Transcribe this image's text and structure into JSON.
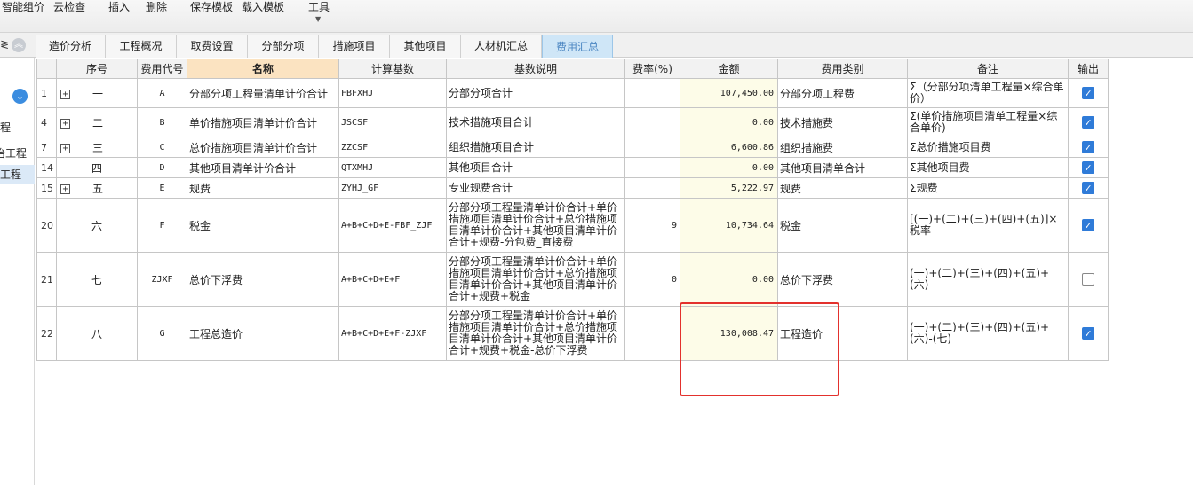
{
  "toolbar": {
    "items": [
      "智能组价",
      "云检查",
      "插入",
      "删除",
      "保存模板",
      "载入模板",
      "工具"
    ]
  },
  "tabs": [
    {
      "label": "造价分析",
      "active": false
    },
    {
      "label": "工程概况",
      "active": false
    },
    {
      "label": "取费设置",
      "active": false
    },
    {
      "label": "分部分项",
      "active": false
    },
    {
      "label": "措施项目",
      "active": false
    },
    {
      "label": "其他项目",
      "active": false
    },
    {
      "label": "人材机汇总",
      "active": false
    },
    {
      "label": "费用汇总",
      "active": true
    }
  ],
  "left_panel": {
    "cut_label": "≷",
    "items": [
      "程",
      "治工程",
      "治工程"
    ]
  },
  "table": {
    "headers": [
      "序号",
      "费用代号",
      "名称",
      "计算基数",
      "基数说明",
      "费率(%)",
      "金额",
      "费用类别",
      "备注",
      "输出"
    ],
    "rows": [
      {
        "rownum": "1",
        "expand": "+",
        "seq": "一",
        "code": "A",
        "name": "分部分项工程量清单计价合计",
        "base": "FBFXHJ",
        "desc": "分部分项合计",
        "rate": "",
        "amount": "107,450.00",
        "category": "分部分项工程费",
        "note": "Σ（分部分项清单工程量×综合单价）",
        "output": true
      },
      {
        "rownum": "4",
        "expand": "+",
        "seq": "二",
        "code": "B",
        "name": "单价措施项目清单计价合计",
        "base": "JSCSF",
        "desc": "技术措施项目合计",
        "rate": "",
        "amount": "0.00",
        "category": "技术措施费",
        "note": "Σ(单价措施项目清单工程量×综合单价)",
        "output": true
      },
      {
        "rownum": "7",
        "expand": "+",
        "seq": "三",
        "code": "C",
        "name": "总价措施项目清单计价合计",
        "base": "ZZCSF",
        "desc": "组织措施项目合计",
        "rate": "",
        "amount": "6,600.86",
        "category": "组织措施费",
        "note": "Σ总价措施项目费",
        "output": true
      },
      {
        "rownum": "14",
        "expand": "",
        "seq": "四",
        "code": "D",
        "name": "其他项目清单计价合计",
        "base": "QTXMHJ",
        "desc": "其他项目合计",
        "rate": "",
        "amount": "0.00",
        "category": "其他项目清单合计",
        "note": "Σ其他项目费",
        "output": true
      },
      {
        "rownum": "15",
        "expand": "+",
        "seq": "五",
        "code": "E",
        "name": "规费",
        "base": "ZYHJ_GF",
        "desc": "专业规费合计",
        "rate": "",
        "amount": "5,222.97",
        "category": "规费",
        "note": "Σ规费",
        "output": true
      },
      {
        "rownum": "20",
        "expand": "",
        "seq": "六",
        "code": "F",
        "name": "税金",
        "base": "A+B+C+D+E-FBF_ZJF",
        "desc": "分部分项工程量清单计价合计+单价措施项目清单计价合计+总价措施项目清单计价合计+其他项目清单计价合计+规费-分包费_直接费",
        "rate": "9",
        "amount": "10,734.64",
        "category": "税金",
        "note": "[(一)+(二)+(三)+(四)+(五)]×税率",
        "output": true
      },
      {
        "rownum": "21",
        "expand": "",
        "seq": "七",
        "code": "ZJXF",
        "name": "总价下浮费",
        "base": "A+B+C+D+E+F",
        "desc": "分部分项工程量清单计价合计+单价措施项目清单计价合计+总价措施项目清单计价合计+其他项目清单计价合计+规费+税金",
        "rate": "0",
        "amount": "0.00",
        "category": "总价下浮费",
        "note": "(一)+(二)+(三)+(四)+(五)+(六)",
        "output": false
      },
      {
        "rownum": "22",
        "expand": "",
        "seq": "八",
        "code": "G",
        "name": "工程总造价",
        "base": "A+B+C+D+E+F-ZJXF",
        "desc": "分部分项工程量清单计价合计+单价措施项目清单计价合计+总价措施项目清单计价合计+其他项目清单计价合计+规费+税金-总价下浮费",
        "rate": "",
        "amount": "130,008.47",
        "category": "工程造价",
        "note": "(一)+(二)+(三)+(四)+(五)+(六)-(七)",
        "output": true
      }
    ]
  },
  "colors": {
    "accent": "#2f7bd8",
    "annotation": "#e3312d",
    "amount_bg": "#fdfce8",
    "header_highlight": "#fbe3c1"
  }
}
